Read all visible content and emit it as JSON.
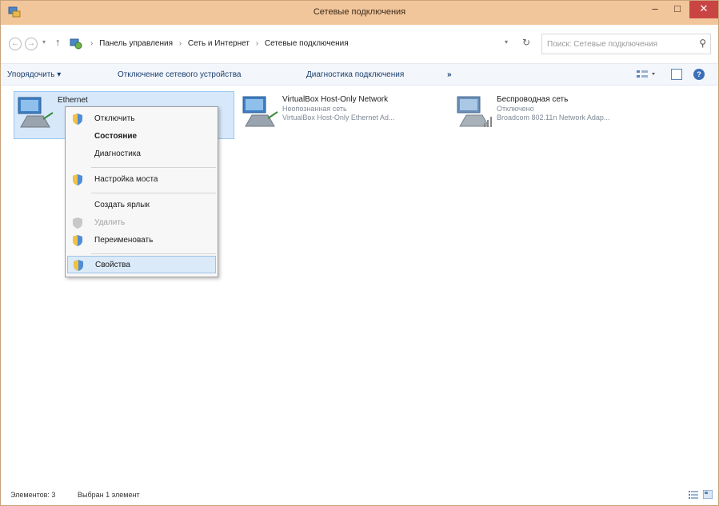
{
  "window": {
    "title": "Сетевые подключения",
    "controls": {
      "minimize": "–",
      "maximize": "□",
      "close": "✕"
    }
  },
  "address": {
    "breadcrumbs": [
      "Панель управления",
      "Сеть и Интернет",
      "Сетевые подключения"
    ],
    "separator": "›",
    "search_placeholder": "Поиск: Сетевые подключения"
  },
  "commandbar": {
    "organize": "Упорядочить ▾",
    "disable_device": "Отключение сетевого устройства",
    "diagnose": "Диагностика подключения",
    "more": "»"
  },
  "connections": [
    {
      "name": "Ethernet",
      "status": "",
      "adapter": "",
      "selected": true
    },
    {
      "name": "VirtualBox Host-Only Network",
      "status": "Неопознанная сеть",
      "adapter": "VirtualBox Host-Only Ethernet Ad...",
      "selected": false
    },
    {
      "name": "Беспроводная сеть",
      "status": "Отключено",
      "adapter": "Broadcom 802.11n Network Adap...",
      "selected": false
    }
  ],
  "context_menu": {
    "items": [
      {
        "label": "Отключить",
        "icon": "shield-icon",
        "bold": false,
        "disabled": false
      },
      {
        "label": "Состояние",
        "icon": "",
        "bold": true,
        "disabled": false
      },
      {
        "label": "Диагностика",
        "icon": "",
        "bold": false,
        "disabled": false
      },
      {
        "label": "Настройка моста",
        "icon": "shield-icon",
        "bold": false,
        "disabled": false
      },
      {
        "label": "Создать ярлык",
        "icon": "",
        "bold": false,
        "disabled": false
      },
      {
        "label": "Удалить",
        "icon": "shield-icon",
        "bold": false,
        "disabled": true
      },
      {
        "label": "Переименовать",
        "icon": "shield-icon",
        "bold": false,
        "disabled": false
      },
      {
        "label": "Свойства",
        "icon": "shield-icon",
        "bold": false,
        "disabled": false,
        "highlighted": true
      }
    ]
  },
  "status": {
    "count": "Элементов: 3",
    "selected": "Выбран 1 элемент"
  },
  "colors": {
    "titlebar": "#f2c69b",
    "close_button": "#c94543",
    "selection": "#d6e8fa",
    "command_text": "#1a3f6e"
  }
}
